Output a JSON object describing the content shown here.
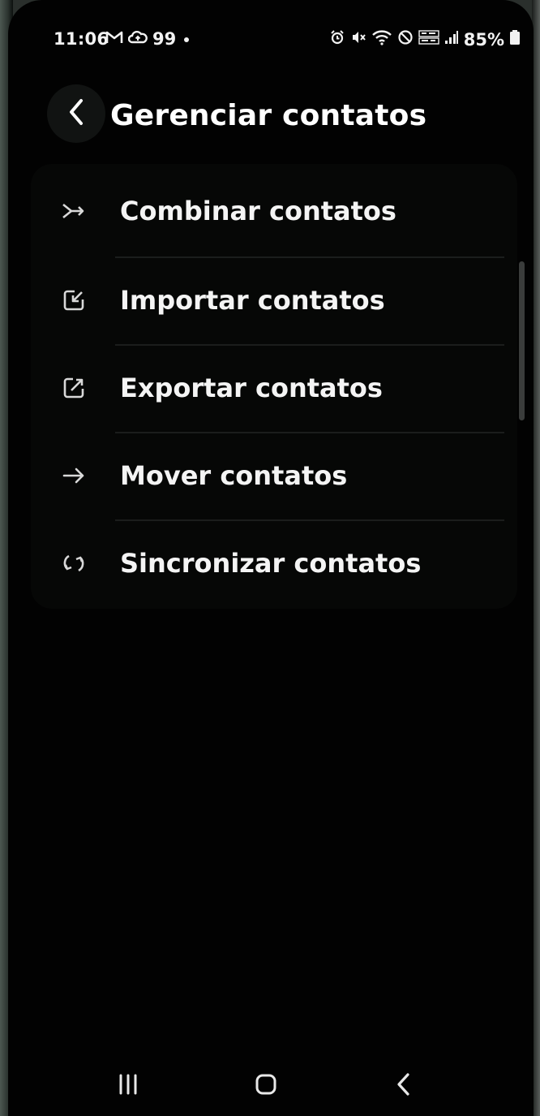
{
  "status_bar": {
    "time": "11:06",
    "notification_count": "99",
    "battery_percent": "85%",
    "left_icons": [
      "gmail-icon",
      "cloud-icon"
    ],
    "right_icons": [
      "alarm-icon",
      "mute-icon",
      "wifi-icon",
      "dnd-icon",
      "volte-icon",
      "signal-icon",
      "battery-icon"
    ]
  },
  "header": {
    "title": "Gerenciar contatos"
  },
  "menu": {
    "items": [
      {
        "label": "Combinar contatos",
        "icon": "merge-icon"
      },
      {
        "label": "Importar contatos",
        "icon": "import-icon"
      },
      {
        "label": "Exportar contatos",
        "icon": "export-icon"
      },
      {
        "label": "Mover contatos",
        "icon": "arrow-right-icon"
      },
      {
        "label": "Sincronizar contatos",
        "icon": "sync-icon"
      }
    ]
  },
  "nav_bar": {
    "buttons": [
      "recents-icon",
      "home-icon",
      "back-icon"
    ]
  },
  "colors": {
    "background": "#020202",
    "text": "#f4f4f4",
    "divider": "#1b1d1c"
  }
}
